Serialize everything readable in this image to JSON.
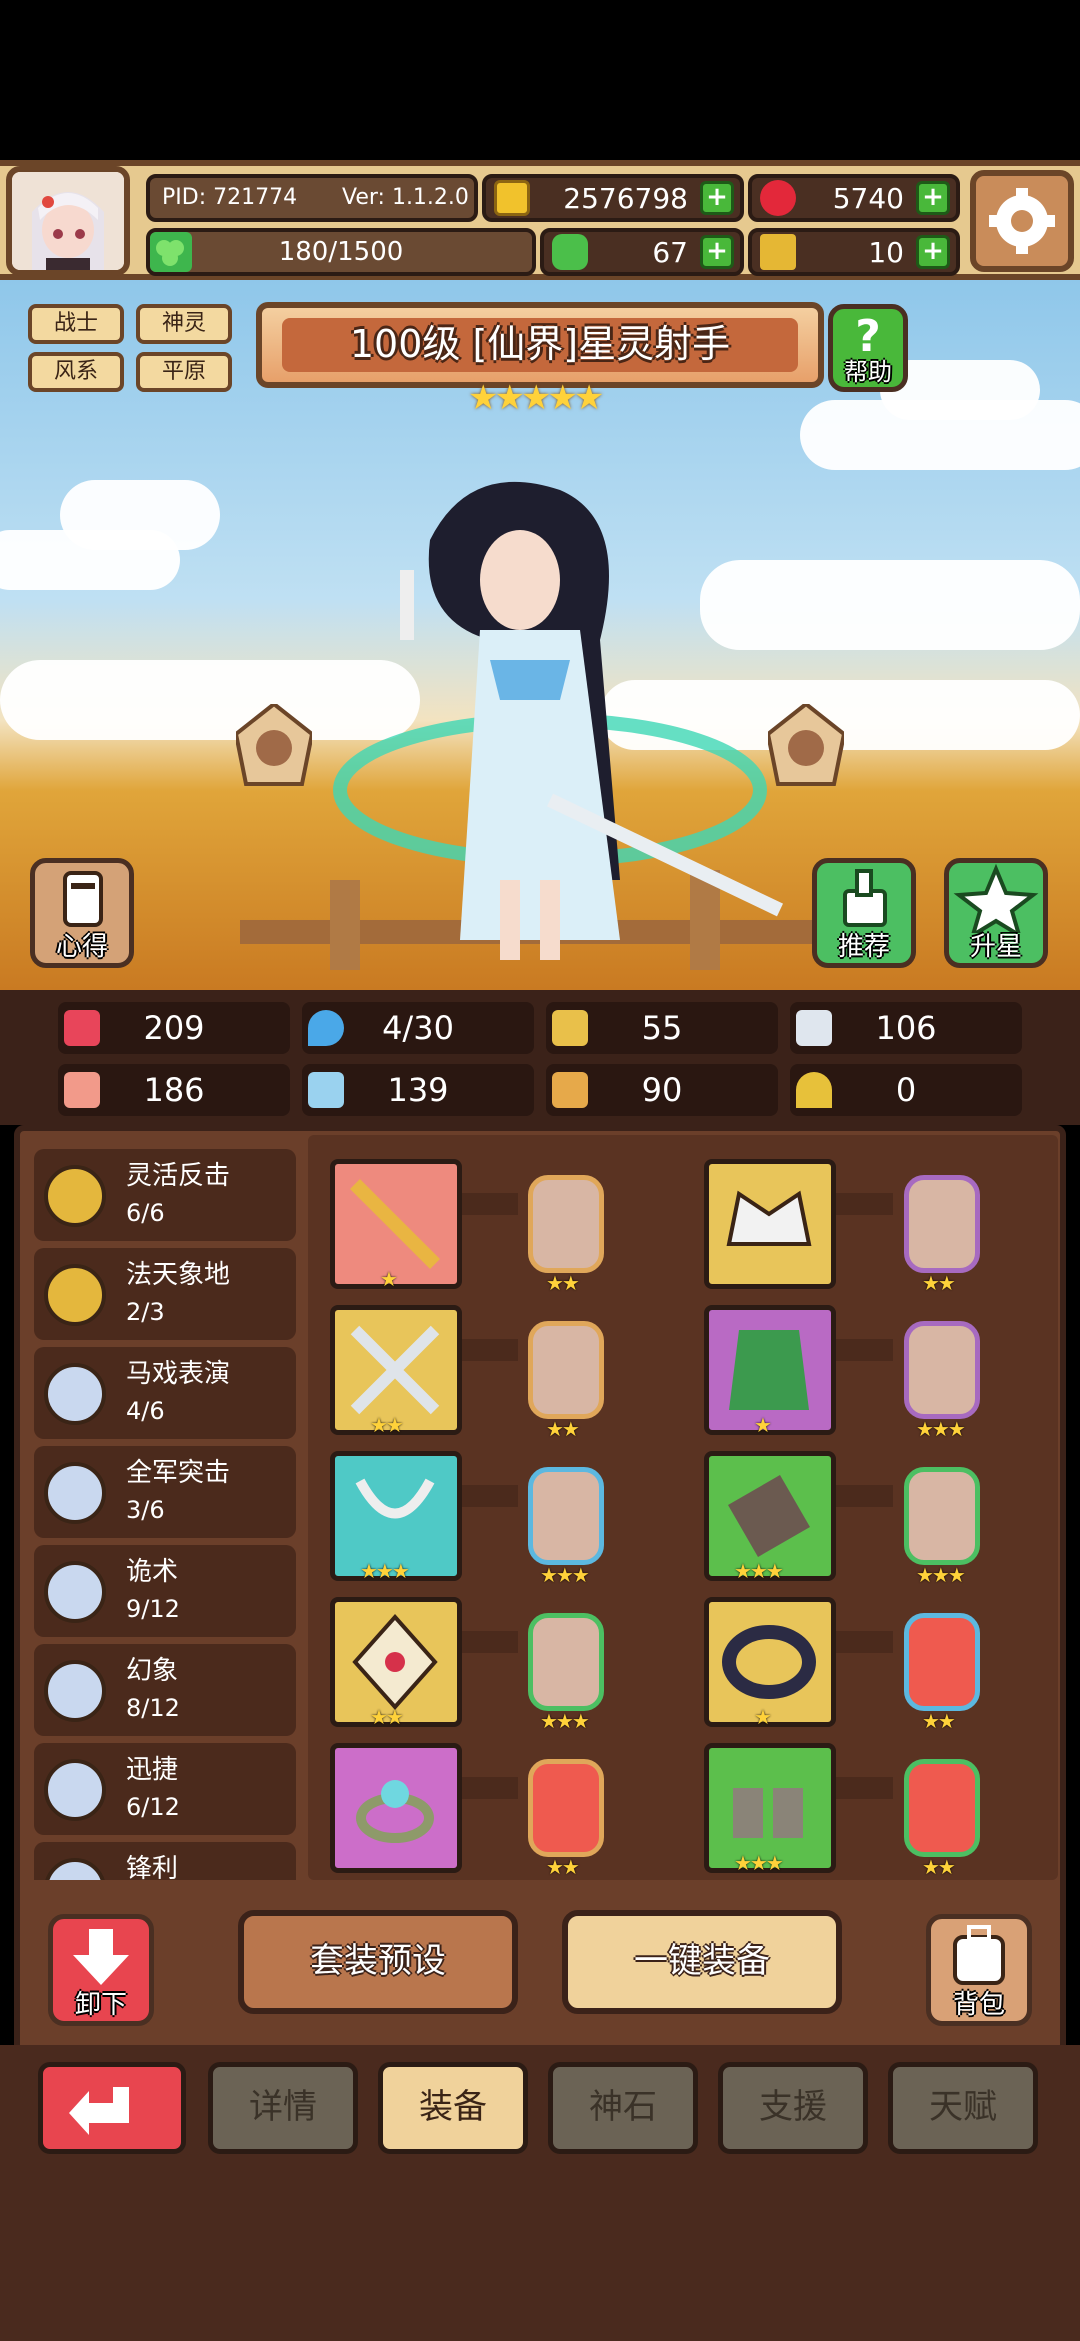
{
  "player": {
    "pid": "PID: 721774",
    "version": "Ver: 1.1.2.0",
    "energy": "180/1500"
  },
  "currencies": {
    "gold": "2576798",
    "ruby": "5740",
    "clover": "67",
    "key": "10"
  },
  "tags": [
    "战士",
    "神灵",
    "风系",
    "平原"
  ],
  "hero": {
    "title": "100级  [仙界]星灵射手",
    "stars": 5
  },
  "buttons": {
    "help": "帮助",
    "insight": "心得",
    "recommend": "推荐",
    "star_up": "升星",
    "unequip": "卸下",
    "bag": "背包",
    "set_preset": "套装预设",
    "one_key_equip": "一键装备"
  },
  "stats": [
    {
      "icon": "heart-icon",
      "value": "209"
    },
    {
      "icon": "water-drop-icon",
      "value": "4/30"
    },
    {
      "icon": "shield-icon",
      "value": "55"
    },
    {
      "icon": "wing-icon",
      "value": "106"
    },
    {
      "icon": "fist-icon",
      "value": "186"
    },
    {
      "icon": "book-icon",
      "value": "139"
    },
    {
      "icon": "stairs-icon",
      "value": "90"
    },
    {
      "icon": "horseshoe-icon",
      "value": "0"
    }
  ],
  "skills": [
    {
      "name": "灵活反击",
      "count": "6/6"
    },
    {
      "name": "法天象地",
      "count": "2/3"
    },
    {
      "name": "马戏表演",
      "count": "4/6"
    },
    {
      "name": "全军突击",
      "count": "3/6"
    },
    {
      "name": "诡术",
      "count": "9/12"
    },
    {
      "name": "幻象",
      "count": "8/12"
    },
    {
      "name": "迅捷",
      "count": "6/12"
    },
    {
      "name": "锋利",
      "count": ""
    }
  ],
  "equipment": [
    {
      "item": "wand-icon",
      "item_stars": 1,
      "gem_stars": 2
    },
    {
      "item": "crown-icon",
      "item_stars": 0,
      "gem_stars": 2
    },
    {
      "item": "crossed-swords-icon",
      "item_stars": 2,
      "gem_stars": 2
    },
    {
      "item": "green-robe-icon",
      "item_stars": 1,
      "gem_stars": 3
    },
    {
      "item": "necklace-icon",
      "item_stars": 3,
      "gem_stars": 3
    },
    {
      "item": "bracer-icon",
      "item_stars": 3,
      "gem_stars": 3
    },
    {
      "item": "amulet-icon",
      "item_stars": 2,
      "gem_stars": 3
    },
    {
      "item": "belt-icon",
      "item_stars": 1,
      "gem_stars": 2
    },
    {
      "item": "ring-icon",
      "item_stars": 0,
      "gem_stars": 2
    },
    {
      "item": "boots-icon",
      "item_stars": 3,
      "gem_stars": 2
    }
  ],
  "tabs": [
    "详情",
    "装备",
    "神石",
    "支援",
    "天赋"
  ],
  "active_tab": "装备"
}
